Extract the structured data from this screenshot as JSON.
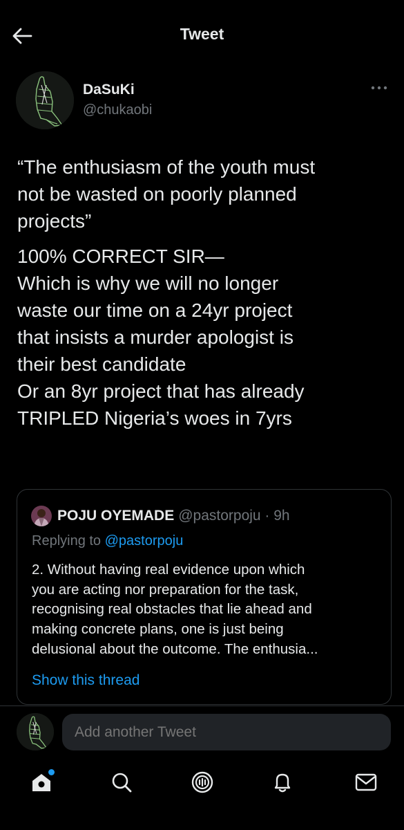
{
  "header": {
    "title": "Tweet"
  },
  "author": {
    "name": "DaSuKi",
    "handle": "@chukaobi"
  },
  "tweet": {
    "lines_a": [
      "“The enthusiasm of the youth must",
      "not be wasted on poorly planned",
      "projects”"
    ],
    "lines_b": [
      "100% CORRECT SIR—",
      "Which is why we will no longer",
      "waste our time on a 24yr project",
      "that insists a murder apologist is",
      "their best candidate",
      "Or an 8yr project that has already",
      "TRIPLED Nigeria’s woes in 7yrs"
    ]
  },
  "quote": {
    "name": "POJU OYEMADE",
    "handle_time": "@pastorpoju · 9h",
    "replying_prefix": "Replying to ",
    "replying_mention": "@pastorpoju",
    "lines": [
      "2. Without having real evidence upon which",
      "you are acting nor preparation for the task,",
      "recognising real obstacles that lie ahead and",
      "making concrete plans, one is just being",
      "delusional about the outcome. The enthusia..."
    ],
    "show_thread": "Show this thread"
  },
  "compose": {
    "placeholder": "Add another Tweet"
  },
  "nav": {
    "items": [
      "home-icon",
      "search-icon",
      "spaces-icon",
      "notifications-icon",
      "messages-icon"
    ],
    "home_badge_color": "#1d9bf0"
  },
  "colors": {
    "accent": "#1d9bf0",
    "secondary_text": "#71767b",
    "background": "#000000"
  }
}
